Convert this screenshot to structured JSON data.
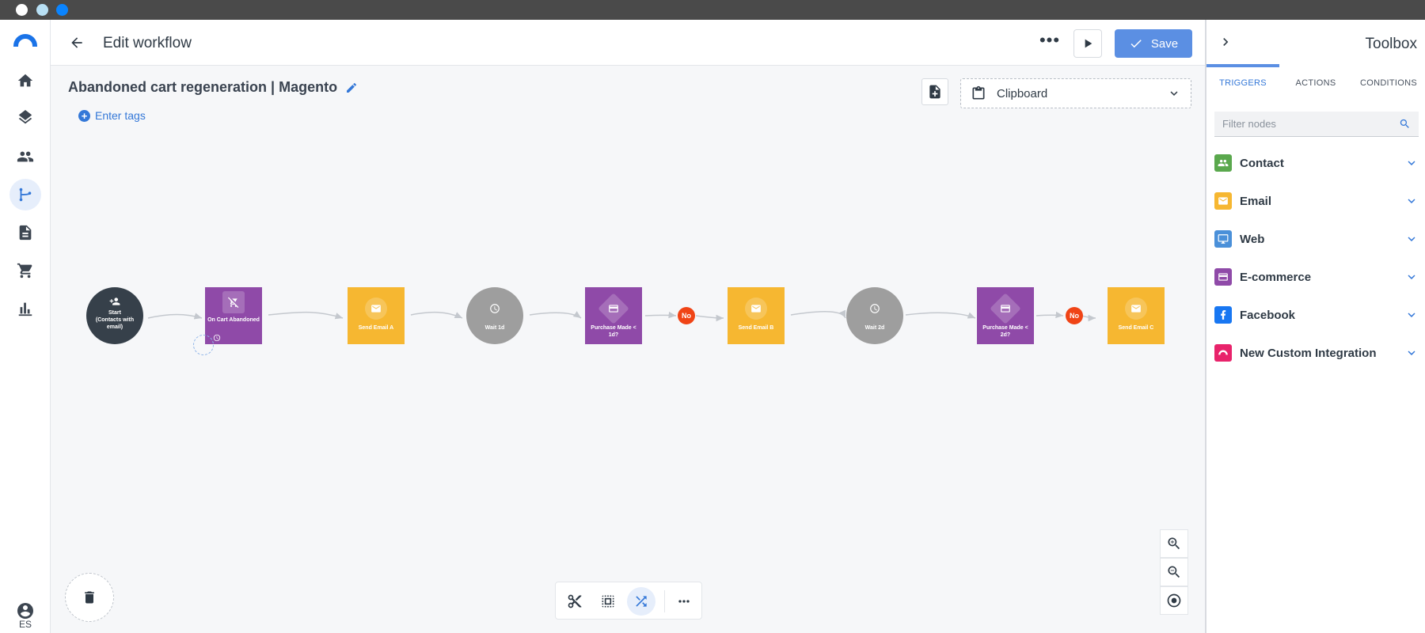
{
  "window": {
    "dot_colors": [
      "#ffffff",
      "#b8e0f5",
      "#0a84ff"
    ]
  },
  "sidebar": {
    "items": [
      {
        "id": "home",
        "icon": "home-icon"
      },
      {
        "id": "layers",
        "icon": "layers-icon"
      },
      {
        "id": "contacts",
        "icon": "people-icon"
      },
      {
        "id": "workflows",
        "icon": "workflow-icon",
        "active": true
      },
      {
        "id": "documents",
        "icon": "document-icon"
      },
      {
        "id": "commerce",
        "icon": "cart-icon"
      },
      {
        "id": "reports",
        "icon": "bar-chart-icon"
      }
    ],
    "language": "ES"
  },
  "header": {
    "title": "Edit workflow",
    "more_label": "•••",
    "save_label": "Save"
  },
  "workflow": {
    "name": "Abandoned cart regeneration | Magento",
    "tags_label": "Enter tags",
    "clipboard_label": "Clipboard",
    "nodes": [
      {
        "id": "start",
        "label": "Start\n(Contacts with email)",
        "color": "#36404a",
        "shape": "circle"
      },
      {
        "id": "trigger",
        "label": "On Cart Abandoned",
        "color": "#8f4aa8",
        "shape": "square"
      },
      {
        "id": "email-a",
        "label": "Send Email A",
        "color": "#f6b731",
        "shape": "square"
      },
      {
        "id": "wait-1",
        "label": "Wait 1d",
        "color": "#9e9e9e",
        "shape": "circle"
      },
      {
        "id": "cond-1",
        "label": "Purchase Made < 1d?",
        "color": "#8f4aa8",
        "shape": "square"
      },
      {
        "id": "email-b",
        "label": "Send Email B",
        "color": "#f6b731",
        "shape": "square"
      },
      {
        "id": "wait-2",
        "label": "Wait 2d",
        "color": "#9e9e9e",
        "shape": "circle"
      },
      {
        "id": "cond-2",
        "label": "Purchase Made < 2d?",
        "color": "#8f4aa8",
        "shape": "square"
      },
      {
        "id": "email-c",
        "label": "Send Email C",
        "color": "#f6b731",
        "shape": "square"
      }
    ],
    "branch_labels": [
      "No",
      "No"
    ]
  },
  "toolbox": {
    "title": "Toolbox",
    "tabs": [
      "TRIGGERS",
      "ACTIONS",
      "CONDITIONS"
    ],
    "active_tab": "TRIGGERS",
    "filter_placeholder": "Filter nodes",
    "categories": [
      {
        "label": "Contact",
        "color": "#5aa84d",
        "icon": "people-icon"
      },
      {
        "label": "Email",
        "color": "#f6b731",
        "icon": "envelope-icon"
      },
      {
        "label": "Web",
        "color": "#4a90d9",
        "icon": "monitor-icon"
      },
      {
        "label": "E-commerce",
        "color": "#8f4aa8",
        "icon": "credit-card-icon"
      },
      {
        "label": "Facebook",
        "color": "#1877f2",
        "icon": "facebook-icon"
      },
      {
        "label": "New Custom Integration",
        "color": "#e8236b",
        "icon": "integration-icon"
      }
    ]
  },
  "colors": {
    "accent": "#5b8fe3",
    "no_badge": "#f04416"
  }
}
